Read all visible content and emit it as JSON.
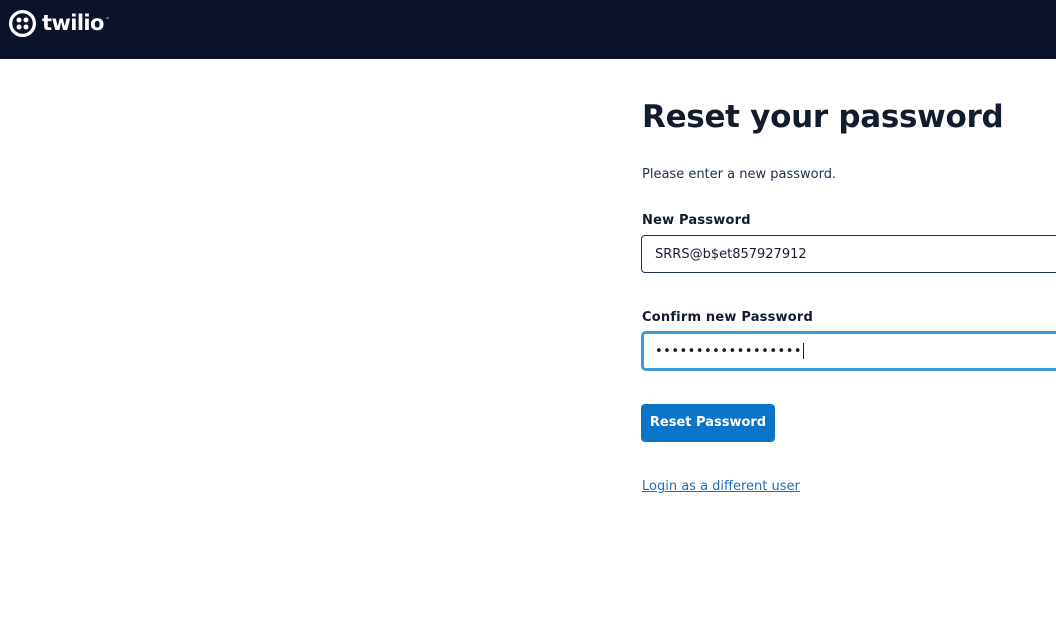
{
  "header": {
    "brand_name": "twilio",
    "brand_trademark": "™",
    "logo_icon": "twilio-logo-icon",
    "background_color": "#0d122b"
  },
  "form": {
    "title": "Reset your password",
    "subtitle": "Please enter a new password.",
    "new_password": {
      "label": "New Password",
      "value": "SRRS@b$et857927912"
    },
    "confirm_password": {
      "label": "Confirm new Password",
      "masked_value": "••••••••••••••••••"
    },
    "submit_label": "Reset Password",
    "alt_login_link": "Login as a different user",
    "accent_color": "#0a74c9",
    "focus_color": "#3b9dd6"
  }
}
